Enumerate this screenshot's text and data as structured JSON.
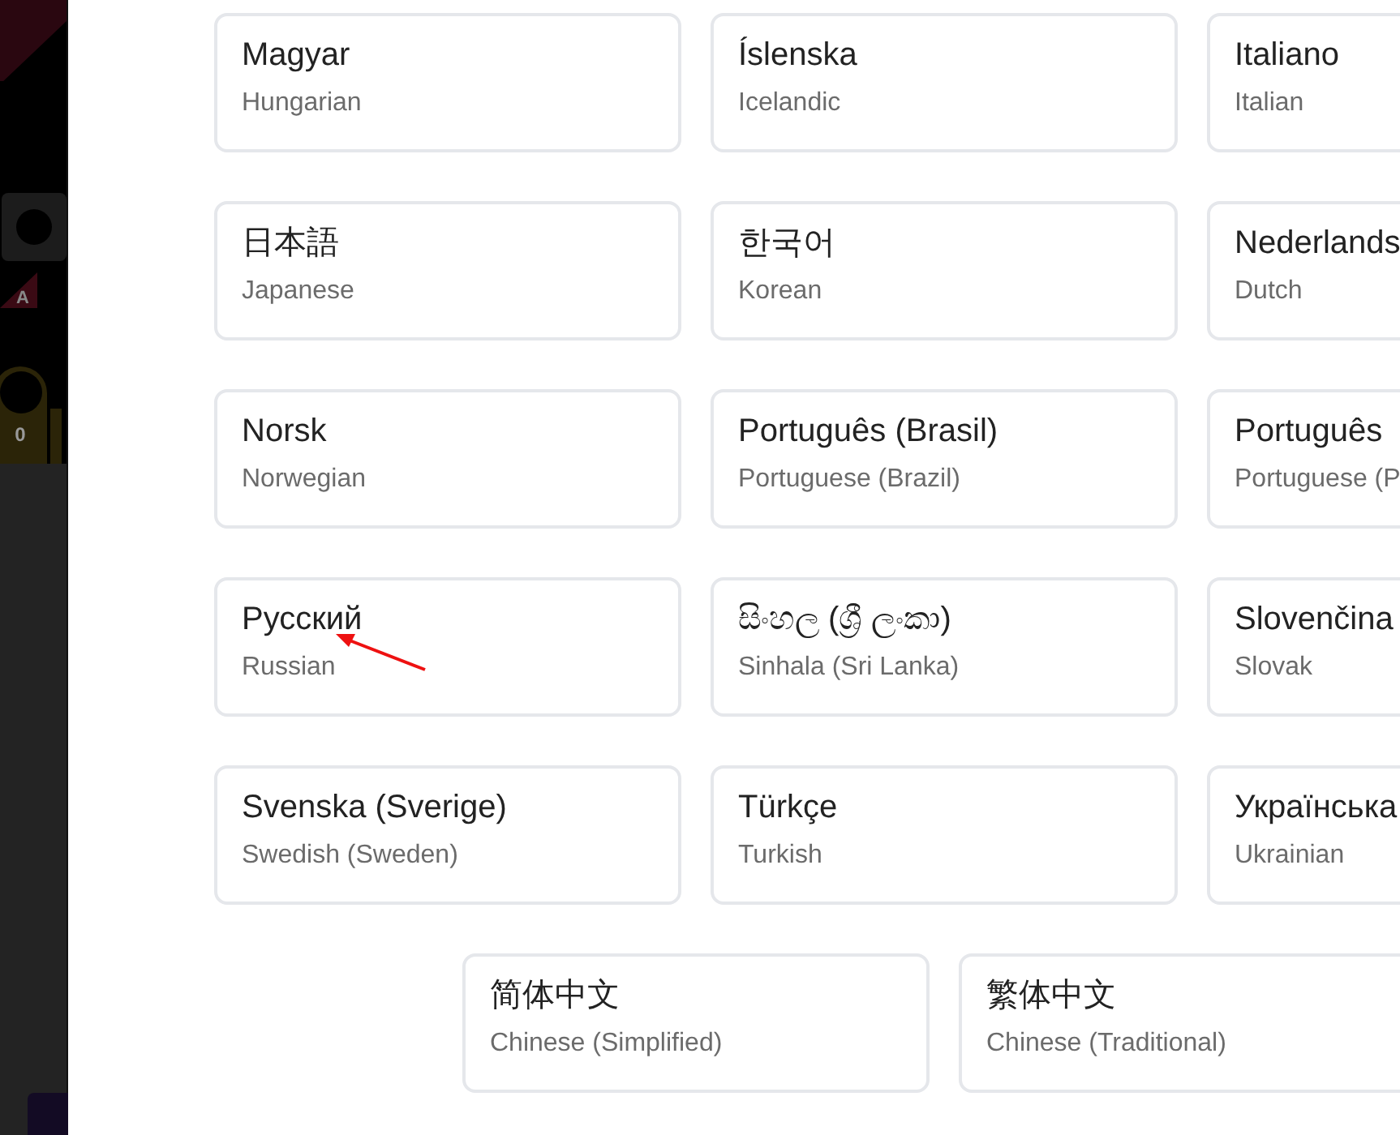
{
  "backdrop": {
    "texts": [
      "A",
      "0"
    ]
  },
  "rows": [
    [
      {
        "name": "Magyar",
        "english": "Hungarian"
      },
      {
        "name": "Íslenska",
        "english": "Icelandic"
      },
      {
        "name": "Italiano",
        "english": "Italian"
      }
    ],
    [
      {
        "name": "日本語",
        "english": "Japanese"
      },
      {
        "name": "한국어",
        "english": "Korean"
      },
      {
        "name": "Nederlands",
        "english": "Dutch"
      }
    ],
    [
      {
        "name": "Norsk",
        "english": "Norwegian"
      },
      {
        "name": "Português (Brasil)",
        "english": "Portuguese (Brazil)"
      },
      {
        "name": "Português",
        "english": "Portuguese (P"
      }
    ],
    [
      {
        "name": "Русский",
        "english": "Russian"
      },
      {
        "name": "සිංහල (ශ්‍රී ලංකා)",
        "english": "Sinhala (Sri Lanka)"
      },
      {
        "name": "Slovenčina",
        "english": "Slovak"
      }
    ],
    [
      {
        "name": "Svenska (Sverige)",
        "english": "Swedish (Sweden)"
      },
      {
        "name": "Türkçe",
        "english": "Turkish"
      },
      {
        "name": "Українська",
        "english": "Ukrainian"
      }
    ],
    [
      {
        "name": "简体中文",
        "english": "Chinese (Simplified)"
      },
      {
        "name": "繁体中文",
        "english": "Chinese (Traditional)"
      }
    ]
  ]
}
